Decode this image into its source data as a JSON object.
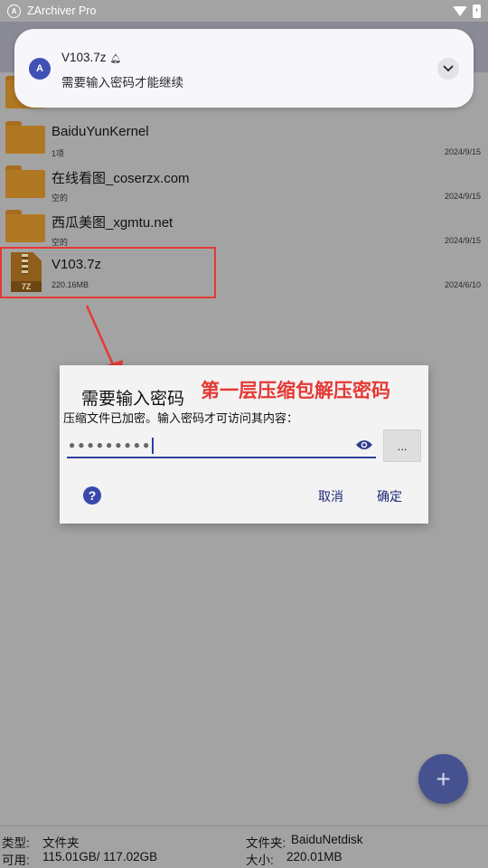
{
  "status_bar": {
    "app_name": "ZArchiver Pro",
    "app_icon_letter": "A"
  },
  "files": [
    {
      "name": "BaiduYunKernel",
      "meta": "1项",
      "date": "2024/9/15",
      "type": "folder"
    },
    {
      "name": "在线看图_coserzx.com",
      "meta": "空的",
      "date": "2024/9/15",
      "type": "folder"
    },
    {
      "name": "西瓜美图_xgmtu.net",
      "meta": "空的",
      "date": "2024/9/15",
      "type": "folder"
    },
    {
      "name": "V103.7z",
      "meta": "220.16MB",
      "date": "2024/6/10",
      "type": "archive",
      "icon_label": "7Z"
    }
  ],
  "notification": {
    "title": "V103.7z",
    "text": "需要输入密码才能继续",
    "icon_letter": "A"
  },
  "dialog": {
    "title": "需要输入密码",
    "annotation": "第一层压缩包解压密码",
    "message": "压缩文件已加密。输入密码才可访问其内容：",
    "password_mask": "●●●●●●●●●",
    "browse_label": "...",
    "help_label": "?",
    "cancel_label": "取消",
    "ok_label": "确定"
  },
  "fab_label": "+",
  "info_bar": {
    "type_label": "类型:",
    "type_value": "文件夹",
    "avail_label": "可用:",
    "avail_value": "115.01GB/ 117.02GB",
    "folder_label": "文件夹:",
    "folder_value": "BaiduNetdisk",
    "size_label": "大小:",
    "size_value": "220.01MB"
  },
  "colors": {
    "accent": "#3949ab",
    "annotation_red": "#e53935",
    "folder": "#b07823"
  }
}
